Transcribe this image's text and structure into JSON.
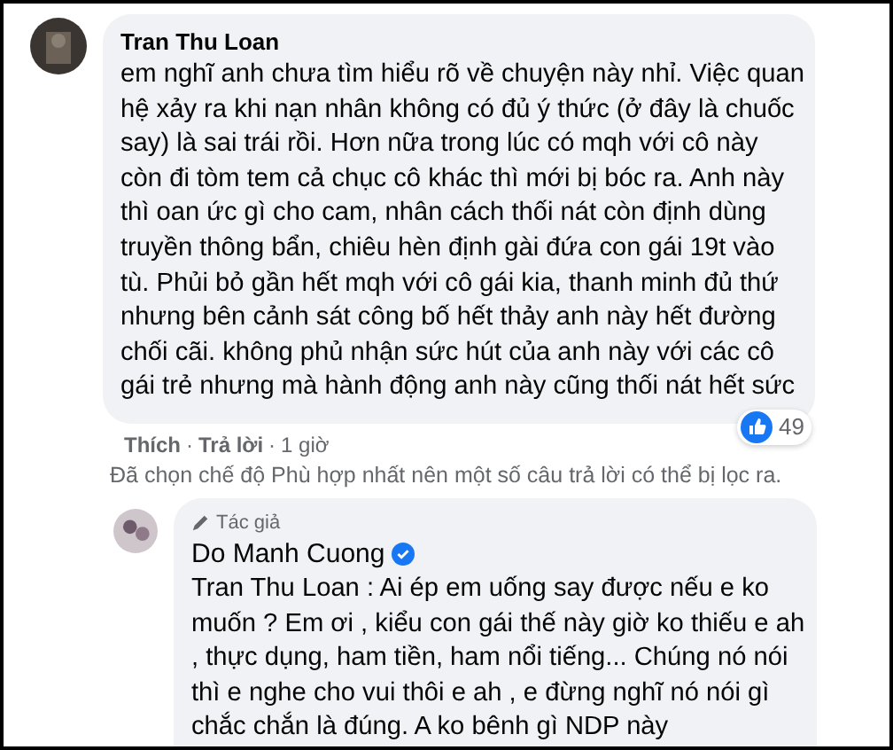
{
  "comment": {
    "author": "Tran Thu Loan",
    "text": "em nghĩ anh chưa tìm hiểu rõ về chuyện này nhỉ. Việc quan hệ xảy ra khi nạn nhân không có đủ ý thức (ở đây là chuốc say) là sai trái rồi. Hơn nữa trong lúc có mqh với cô này còn đi tòm tem cả chục cô khác thì mới bị bóc ra. Anh này thì oan ức gì cho cam, nhân cách thối nát còn định dùng truyền thông bẩn, chiêu hèn định gài đứa con gái 19t vào tù. Phủi bỏ gần hết mqh với cô gái kia, thanh minh đủ thứ nhưng bên cảnh sát công bố hết thảy anh này hết đường chối cãi. không phủ nhận sức hút của anh này với các cô gái trẻ nhưng mà hành động anh này cũng thối nát hết sức",
    "reaction_count": "49",
    "actions": [
      {
        "label": "Thích",
        "kind": "link"
      },
      {
        "label": "Trả lời",
        "kind": "link"
      },
      {
        "label": "1 giờ",
        "kind": "time"
      }
    ],
    "separator": "·"
  },
  "filter_note": "Đã chọn chế độ Phù hợp nhất nên một số câu trả lời có thể bị lọc ra.",
  "reply": {
    "badge": "Tác giả",
    "author": "Do Manh Cuong",
    "verified": true,
    "text": "Tran Thu Loan : Ai ép em uống say được nếu e ko muốn ? Em ơi , kiểu con gái thế này giờ ko thiếu e ah , thực dụng, ham tiền, ham nổi tiếng... Chúng nó nói thì e nghe cho vui thôi e ah , e đừng nghĩ nó nói gì chắc chắn là đúng. A ko bênh gì NDP này"
  }
}
